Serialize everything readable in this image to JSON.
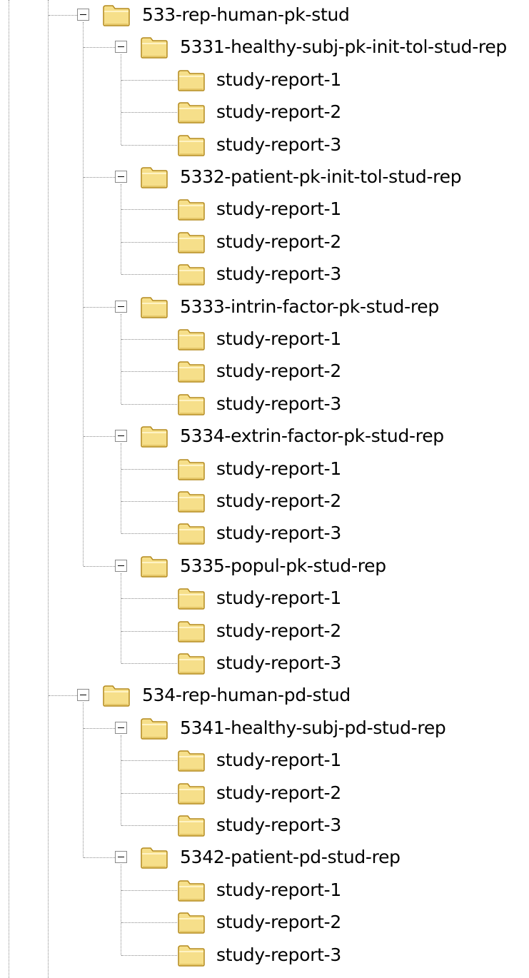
{
  "folder_tree": [
    {
      "label": "533-rep-human-pk-stud",
      "expanded": true,
      "children": [
        {
          "label": "5331-healthy-subj-pk-init-tol-stud-rep",
          "expanded": true,
          "children": [
            {
              "label": "study-report-1"
            },
            {
              "label": "study-report-2"
            },
            {
              "label": "study-report-3"
            }
          ]
        },
        {
          "label": "5332-patient-pk-init-tol-stud-rep",
          "expanded": true,
          "children": [
            {
              "label": "study-report-1"
            },
            {
              "label": "study-report-2"
            },
            {
              "label": "study-report-3"
            }
          ]
        },
        {
          "label": "5333-intrin-factor-pk-stud-rep",
          "expanded": true,
          "children": [
            {
              "label": "study-report-1"
            },
            {
              "label": "study-report-2"
            },
            {
              "label": "study-report-3"
            }
          ]
        },
        {
          "label": "5334-extrin-factor-pk-stud-rep",
          "expanded": true,
          "children": [
            {
              "label": "study-report-1"
            },
            {
              "label": "study-report-2"
            },
            {
              "label": "study-report-3"
            }
          ]
        },
        {
          "label": "5335-popul-pk-stud-rep",
          "expanded": true,
          "children": [
            {
              "label": "study-report-1"
            },
            {
              "label": "study-report-2"
            },
            {
              "label": "study-report-3"
            }
          ]
        }
      ]
    },
    {
      "label": "534-rep-human-pd-stud",
      "expanded": true,
      "children": [
        {
          "label": "5341-healthy-subj-pd-stud-rep",
          "expanded": true,
          "children": [
            {
              "label": "study-report-1"
            },
            {
              "label": "study-report-2"
            },
            {
              "label": "study-report-3"
            }
          ]
        },
        {
          "label": "5342-patient-pd-stud-rep",
          "expanded": true,
          "children": [
            {
              "label": "study-report-1"
            },
            {
              "label": "study-report-2"
            },
            {
              "label": "study-report-3"
            }
          ]
        }
      ]
    }
  ],
  "colors": {
    "folder_fill": "#f6df8a",
    "folder_outline": "#b48a1e",
    "connector": "#8c8c8c"
  }
}
